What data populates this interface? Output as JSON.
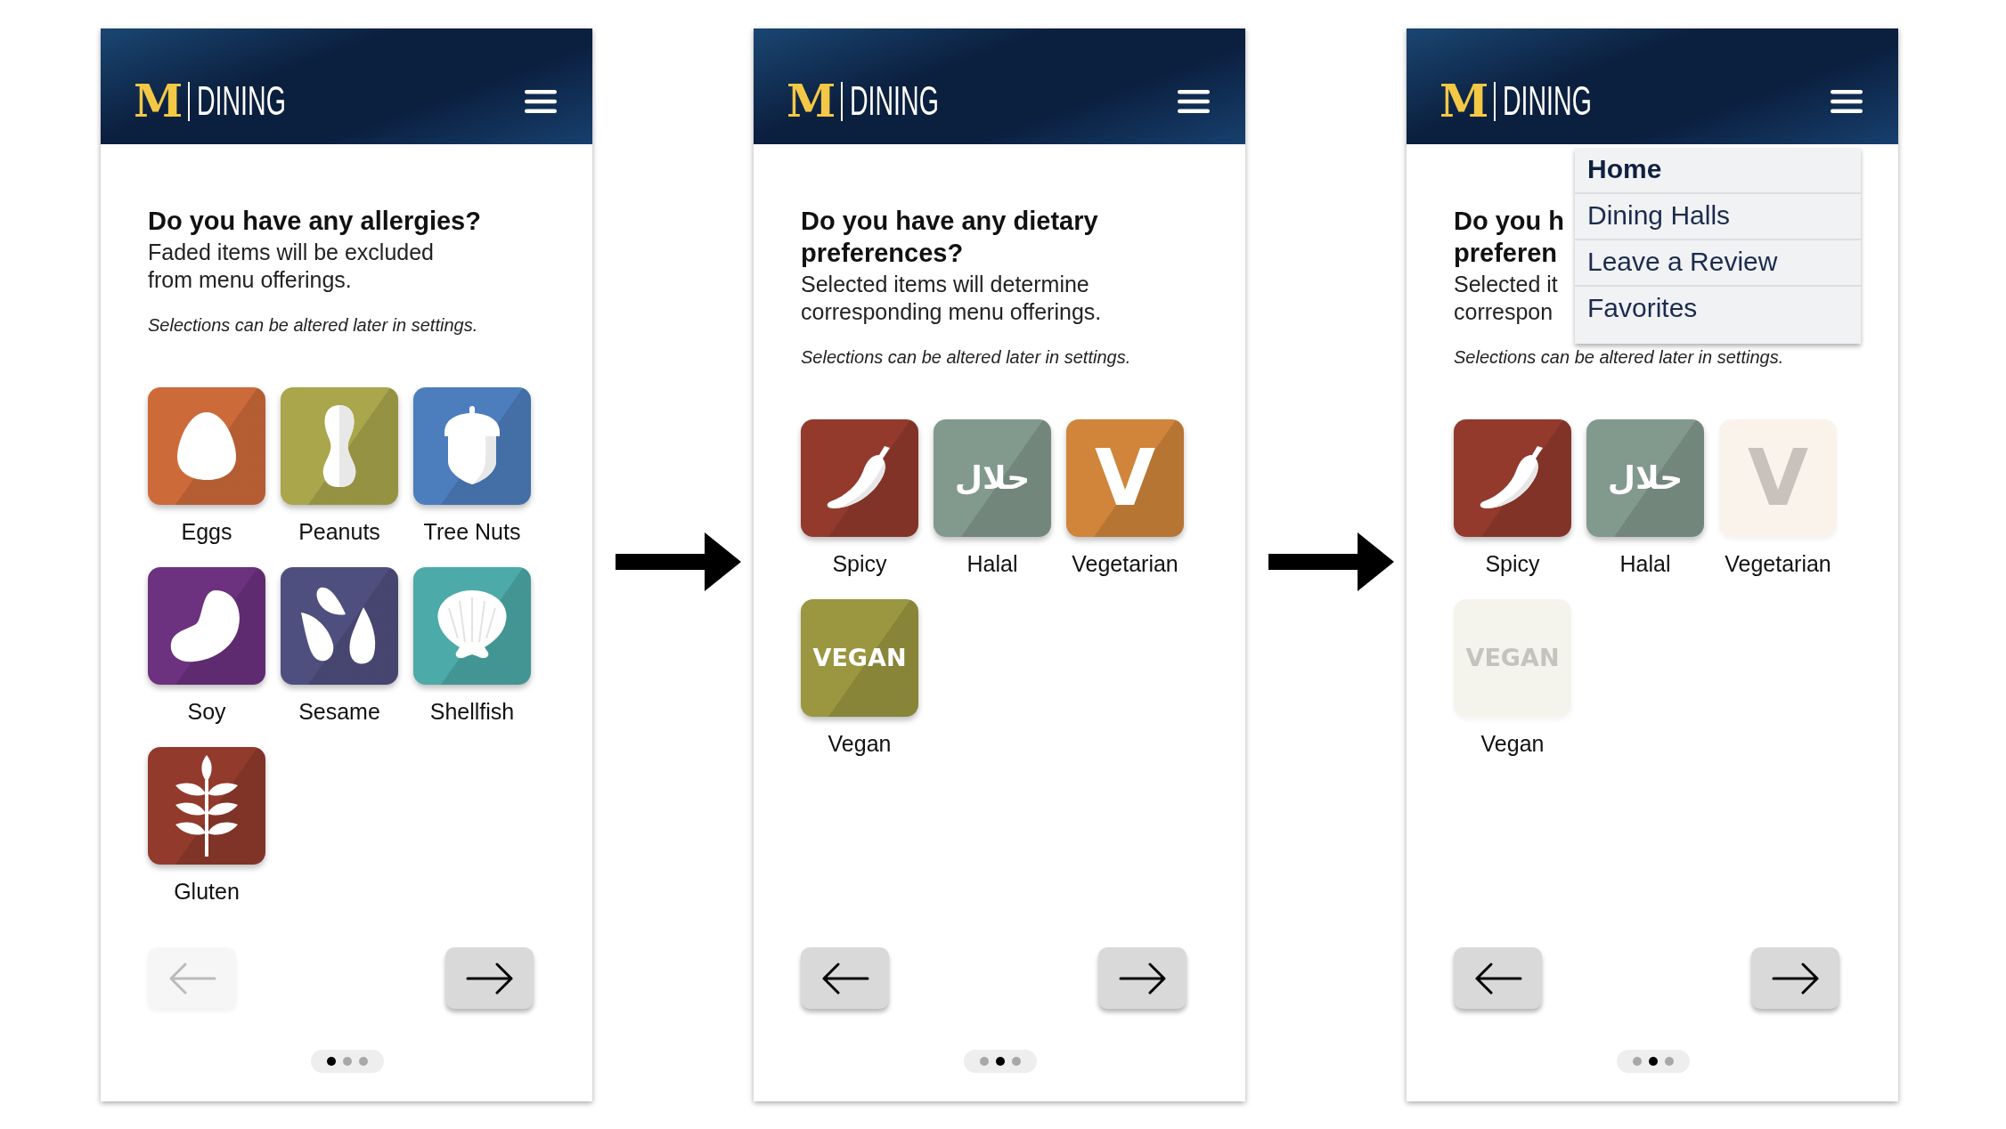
{
  "screens": [
    {
      "kind": "allergies",
      "header": {
        "logo_mark": "M",
        "logo_text": "DINING"
      },
      "title_lines": [
        "Do you have any allergies?"
      ],
      "subtitle_lines": [
        "Faded items will be excluded",
        "from menu offerings."
      ],
      "note": "Selections can be altered later in settings.",
      "options": [
        {
          "label": "Eggs",
          "color": "#cd6a3a",
          "selected": true
        },
        {
          "label": "Peanuts",
          "color": "#a9a64b",
          "selected": true
        },
        {
          "label": "Tree Nuts",
          "color": "#4c7dbd",
          "selected": true
        },
        {
          "label": "Soy",
          "color": "#6c317f",
          "selected": true
        },
        {
          "label": "Sesame",
          "color": "#4f4f7f",
          "selected": true
        },
        {
          "label": "Shellfish",
          "color": "#4caaa8",
          "selected": true
        },
        {
          "label": "Gluten",
          "color": "#923a2c",
          "selected": true
        }
      ],
      "back_button": {
        "disabled": true
      },
      "next_button": {
        "disabled": false
      },
      "pager": [
        {
          "selected": true
        },
        {
          "selected": false
        },
        {
          "selected": false
        }
      ]
    },
    {
      "kind": "preferences",
      "header": {
        "logo_mark": "M",
        "logo_text": "DINING"
      },
      "title_lines": [
        "Do you have any dietary",
        "preferences?"
      ],
      "subtitle_lines": [
        "Selected items will determine",
        "corresponding menu offerings."
      ],
      "note": "Selections can be altered later in settings.",
      "options": [
        {
          "label": "Spicy",
          "color": "#933a2d",
          "selected": true
        },
        {
          "label": "Halal",
          "color": "#82998d",
          "selected": true,
          "glyph": "حلال"
        },
        {
          "label": "Vegetarian",
          "color": "#d0853b",
          "selected": true,
          "glyph": "V"
        },
        {
          "label": "Vegan",
          "color": "#9b9640",
          "selected": true,
          "glyph": "VEGAN"
        }
      ],
      "back_button": {
        "disabled": false
      },
      "next_button": {
        "disabled": false
      },
      "pager": [
        {
          "selected": false
        },
        {
          "selected": true
        },
        {
          "selected": false
        }
      ]
    },
    {
      "kind": "preferences",
      "header": {
        "logo_mark": "M",
        "logo_text": "DINING"
      },
      "title_lines": [
        "Do you h",
        "preferen"
      ],
      "subtitle_lines": [
        "Selected it",
        "correspon"
      ],
      "note": "Selections can be altered later in settings.",
      "menu_items": [
        {
          "label": "Home",
          "selected": true
        },
        {
          "label": "Dining Halls",
          "selected": false
        },
        {
          "label": "Leave a Review",
          "selected": false
        },
        {
          "label": "Favorites",
          "selected": false
        }
      ],
      "options": [
        {
          "label": "Spicy",
          "color": "#933a2d",
          "selected": true
        },
        {
          "label": "Halal",
          "color": "#82998d",
          "selected": true,
          "glyph": "حلال"
        },
        {
          "label": "Vegetarian",
          "color": "#faf3ec",
          "selected": false,
          "glyph": "V"
        },
        {
          "label": "Vegan",
          "color": "#f5f4ec",
          "selected": false,
          "glyph": "VEGAN"
        }
      ],
      "back_button": {
        "disabled": false
      },
      "next_button": {
        "disabled": false
      },
      "pager": [
        {
          "selected": false
        },
        {
          "selected": true
        },
        {
          "selected": false
        }
      ]
    }
  ]
}
